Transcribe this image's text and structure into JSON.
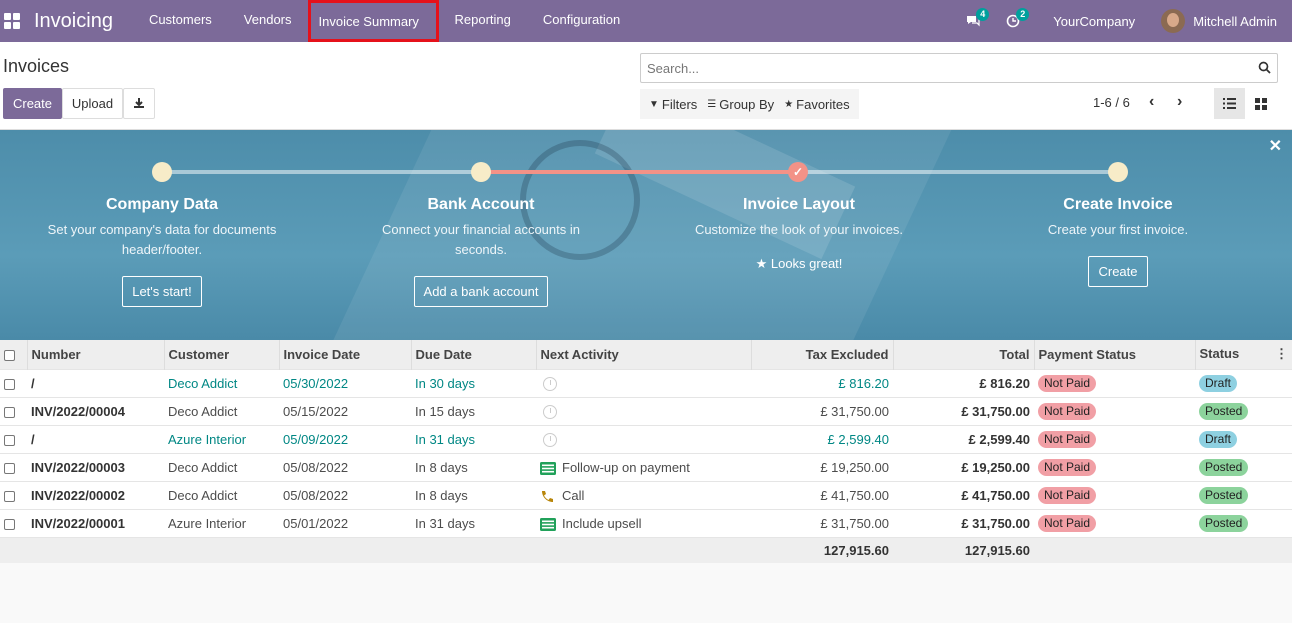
{
  "navbar": {
    "app_name": "Invoicing",
    "menu": [
      "Customers",
      "Vendors",
      "Invoice Summary",
      "Reporting",
      "Configuration"
    ],
    "messages_count": "4",
    "activities_count": "2",
    "company": "YourCompany",
    "user": "Mitchell Admin"
  },
  "control": {
    "title": "Invoices",
    "create_label": "Create",
    "upload_label": "Upload",
    "search_placeholder": "Search...",
    "filters_label": "Filters",
    "groupby_label": "Group By",
    "favorites_label": "Favorites",
    "pager": "1-6 / 6"
  },
  "banner": {
    "steps": [
      {
        "title": "Company Data",
        "desc": "Set your company's data for documents header/footer.",
        "button": "Let's start!"
      },
      {
        "title": "Bank Account",
        "desc": "Connect your financial accounts in seconds.",
        "button": "Add a bank account"
      },
      {
        "title": "Invoice Layout",
        "desc": "Customize the look of your invoices.",
        "done": "Looks great!"
      },
      {
        "title": "Create Invoice",
        "desc": "Create your first invoice.",
        "button": "Create"
      }
    ],
    "done_check": "✓"
  },
  "table": {
    "headers": [
      "Number",
      "Customer",
      "Invoice Date",
      "Due Date",
      "Next Activity",
      "Tax Excluded",
      "Total",
      "Payment Status",
      "Status"
    ],
    "rows": [
      {
        "number": "/",
        "customer": "Deco Addict",
        "invoice_date": "05/30/2022",
        "due_date": "In 30 days",
        "activity": "",
        "tax_excluded": "£ 816.20",
        "total": "£ 816.20",
        "payment_status": "Not Paid",
        "status": "Draft",
        "draft": true
      },
      {
        "number": "INV/2022/00004",
        "customer": "Deco Addict",
        "invoice_date": "05/15/2022",
        "due_date": "In 15 days",
        "activity": "",
        "tax_excluded": "£ 31,750.00",
        "total": "£ 31,750.00",
        "payment_status": "Not Paid",
        "status": "Posted",
        "draft": false
      },
      {
        "number": "/",
        "customer": "Azure Interior",
        "invoice_date": "05/09/2022",
        "due_date": "In 31 days",
        "activity": "",
        "tax_excluded": "£ 2,599.40",
        "total": "£ 2,599.40",
        "payment_status": "Not Paid",
        "status": "Draft",
        "draft": true
      },
      {
        "number": "INV/2022/00003",
        "customer": "Deco Addict",
        "invoice_date": "05/08/2022",
        "due_date": "In 8 days",
        "activity": "Follow-up on payment",
        "activity_icon": "todo",
        "tax_excluded": "£ 19,250.00",
        "total": "£ 19,250.00",
        "payment_status": "Not Paid",
        "status": "Posted",
        "draft": false
      },
      {
        "number": "INV/2022/00002",
        "customer": "Deco Addict",
        "invoice_date": "05/08/2022",
        "due_date": "In 8 days",
        "activity": "Call",
        "activity_icon": "phone",
        "tax_excluded": "£ 41,750.00",
        "total": "£ 41,750.00",
        "payment_status": "Not Paid",
        "status": "Posted",
        "draft": false
      },
      {
        "number": "INV/2022/00001",
        "customer": "Azure Interior",
        "invoice_date": "05/01/2022",
        "due_date": "In 31 days",
        "activity": "Include upsell",
        "activity_icon": "todo",
        "tax_excluded": "£ 31,750.00",
        "total": "£ 31,750.00",
        "payment_status": "Not Paid",
        "status": "Posted",
        "draft": false
      }
    ],
    "totals": {
      "tax_excluded": "127,915.60",
      "total": "127,915.60"
    }
  }
}
